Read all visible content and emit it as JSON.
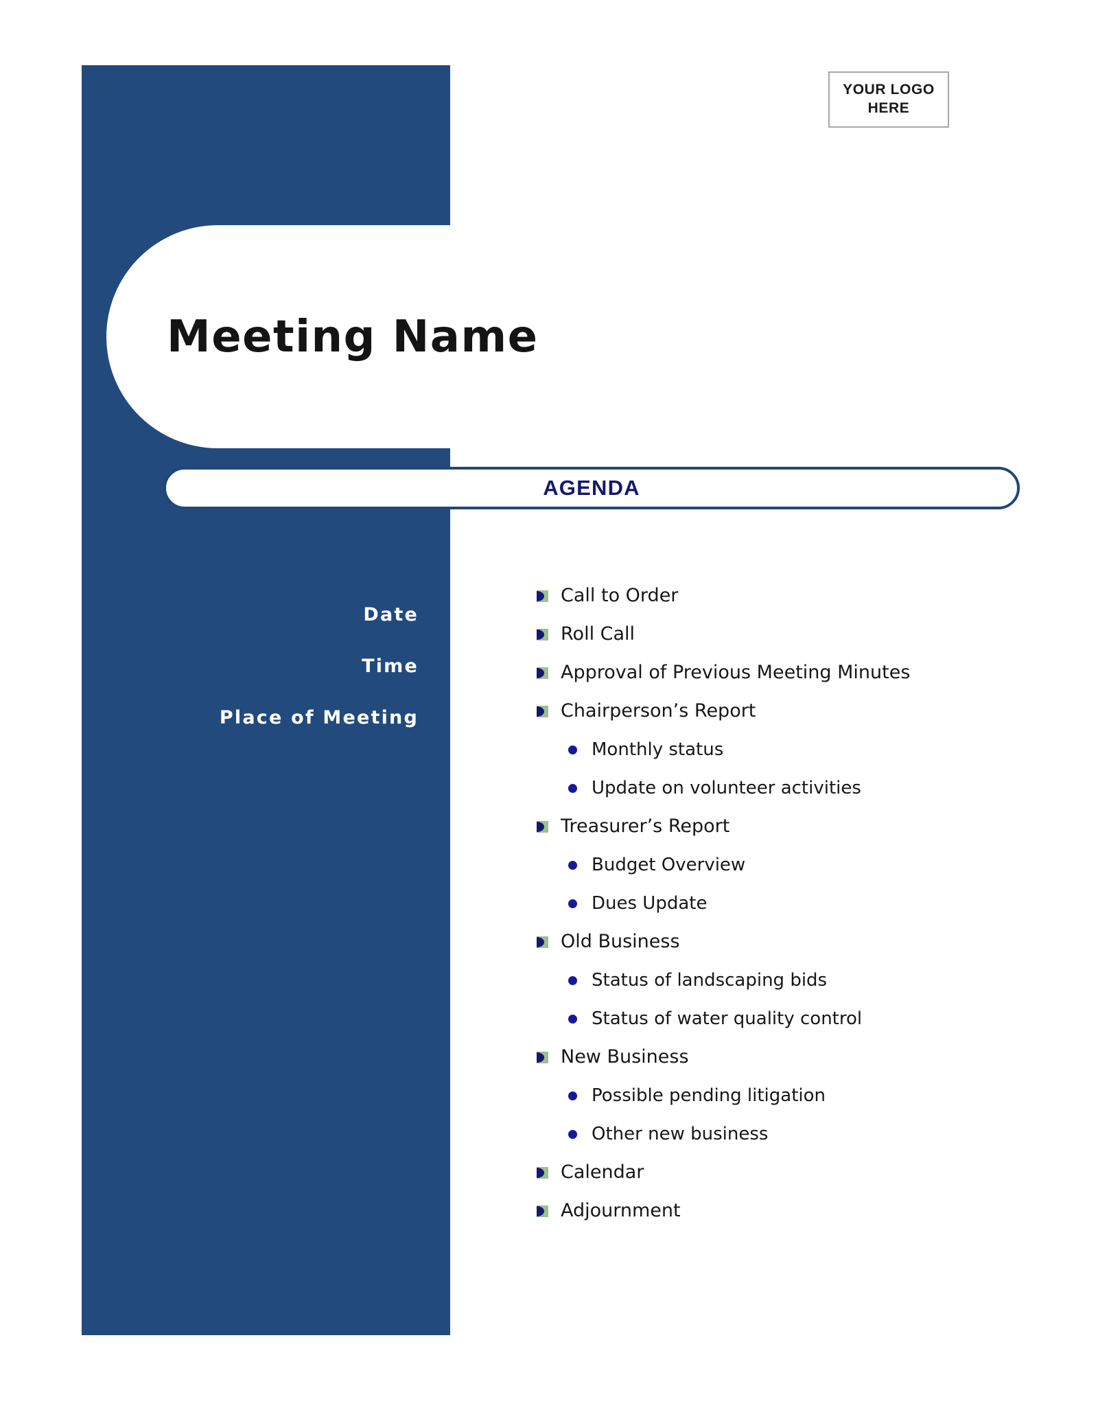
{
  "document": {
    "title": "Meeting Name",
    "section_heading": "AGENDA"
  },
  "logo": {
    "line1": "YOUR LOGO",
    "line2": "HERE"
  },
  "sidebar": {
    "fields": [
      {
        "label": "Date"
      },
      {
        "label": "Time"
      },
      {
        "label": "Place of Meeting"
      }
    ]
  },
  "agenda": {
    "items": [
      {
        "level": 1,
        "label": "Call to Order"
      },
      {
        "level": 1,
        "label": "Roll Call"
      },
      {
        "level": 1,
        "label": "Approval of Previous Meeting Minutes"
      },
      {
        "level": 1,
        "label": "Chairperson’s Report"
      },
      {
        "level": 2,
        "label": "Monthly status"
      },
      {
        "level": 2,
        "label": "Update on volunteer activities"
      },
      {
        "level": 1,
        "label": "Treasurer’s Report"
      },
      {
        "level": 2,
        "label": "Budget Overview"
      },
      {
        "level": 2,
        "label": "Dues Update"
      },
      {
        "level": 1,
        "label": "Old Business"
      },
      {
        "level": 2,
        "label": "Status of landscaping bids"
      },
      {
        "level": 2,
        "label": "Status of water quality control"
      },
      {
        "level": 1,
        "label": "New Business"
      },
      {
        "level": 2,
        "label": "Possible pending litigation"
      },
      {
        "level": 2,
        "label": "Other new business"
      },
      {
        "level": 1,
        "label": "Calendar"
      },
      {
        "level": 1,
        "label": "Adjournment"
      }
    ]
  },
  "colors": {
    "panel_blue": "#224a7d",
    "accent_navy": "#14186e",
    "marker_green": "#9dc08f",
    "page_background": "#ffffff"
  }
}
